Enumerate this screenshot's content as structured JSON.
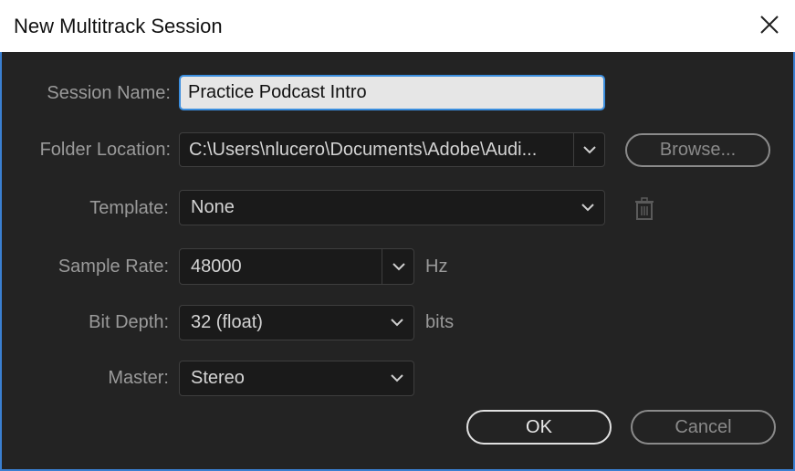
{
  "window": {
    "title": "New Multitrack Session"
  },
  "fields": {
    "session_name": {
      "label": "Session Name:",
      "value": "Practice Podcast Intro"
    },
    "folder_location": {
      "label": "Folder Location:",
      "value": "C:\\Users\\nlucero\\Documents\\Adobe\\Audi..."
    },
    "template": {
      "label": "Template:",
      "value": "None"
    },
    "sample_rate": {
      "label": "Sample Rate:",
      "value": "48000",
      "unit": "Hz"
    },
    "bit_depth": {
      "label": "Bit Depth:",
      "value": "32 (float)",
      "unit": "bits"
    },
    "master": {
      "label": "Master:",
      "value": "Stereo"
    }
  },
  "buttons": {
    "browse": "Browse...",
    "ok": "OK",
    "cancel": "Cancel"
  },
  "icons": {
    "close": "close-icon",
    "delete_template": "trash-icon",
    "dropdown": "chevron-down-icon"
  },
  "colors": {
    "background": "#232323",
    "accent": "#3b8ede",
    "label": "#9a9a9a"
  }
}
